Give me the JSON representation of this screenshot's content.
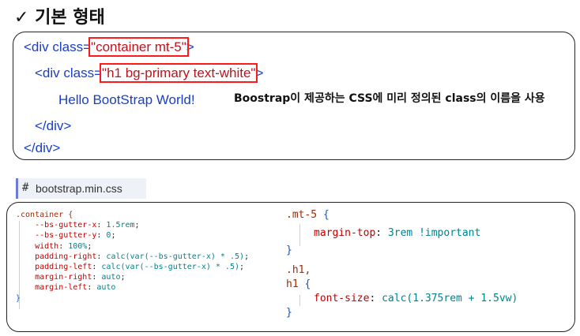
{
  "title": "✓ 기본 형태",
  "html_example": {
    "line1": {
      "prefix": "<div class=",
      "value": "\"container mt-5\"",
      "suffix": ">"
    },
    "line2": {
      "prefix": "<div class=",
      "value": "\"h1 bg-primary text-white\"",
      "suffix": ">"
    },
    "line3": "Hello BootStrap World!",
    "line4": "</div>",
    "line5": "</div>",
    "note": "Boostrap이 제공하는 CSS에 미리 정의된 class의 이름을 사용"
  },
  "file_tab": {
    "icon": "hash-icon",
    "label": "#",
    "filename": "bootstrap.min.css"
  },
  "css_left": {
    "selector": ".container {",
    "rules": [
      {
        "prop": "--bs-gutter-x",
        "value": "1.5rem"
      },
      {
        "prop": "--bs-gutter-y",
        "value": "0"
      },
      {
        "prop": "width",
        "value": "100%"
      },
      {
        "prop": "padding-right",
        "value": "calc(var(--bs-gutter-x) * .5)"
      },
      {
        "prop": "padding-left",
        "value": "calc(var(--bs-gutter-x) * .5)"
      },
      {
        "prop": "margin-right",
        "value": "auto"
      },
      {
        "prop": "margin-left",
        "value": "auto"
      }
    ],
    "close": "}"
  },
  "css_right": {
    "sel1": ".mt-5",
    "rule1": {
      "prop": "margin-top",
      "value": "3rem !important"
    },
    "sel2a": ".h1,",
    "sel2b": "h1",
    "rule2": {
      "prop": "font-size",
      "value": "calc(1.375rem + 1.5vw)"
    },
    "open": "{",
    "close": "}"
  },
  "colors": {
    "highlight_box": "#ff1a1a",
    "html_text": "#1a3fc7",
    "string": "#c0121b"
  }
}
